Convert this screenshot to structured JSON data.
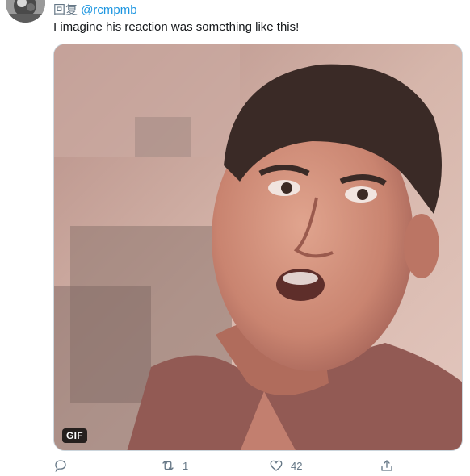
{
  "reply": {
    "prefix": "回复",
    "handle": "@rcmpmb"
  },
  "tweet": {
    "text": "I imagine his reaction was something like this!"
  },
  "media": {
    "badge": "GIF"
  },
  "actions": {
    "reply_icon": "comment-icon",
    "retweet_icon": "retweet-icon",
    "retweet_count": "1",
    "like_icon": "heart-icon",
    "like_count": "42",
    "share_icon": "share-icon"
  },
  "colors": {
    "link": "#1b95e0",
    "muted": "#657786",
    "text": "#14171a"
  }
}
